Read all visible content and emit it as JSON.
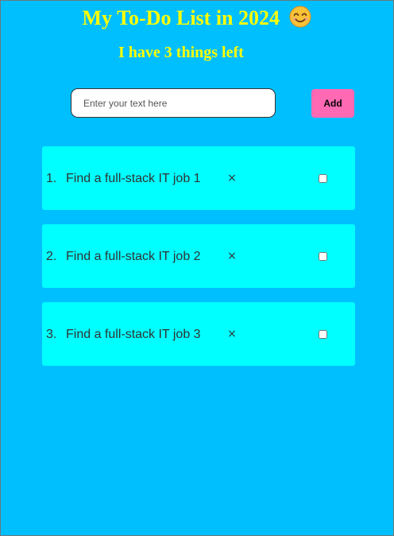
{
  "header": {
    "title": "My To-Do List in 2024",
    "subtitle": "I have 3 things left"
  },
  "form": {
    "input_placeholder": "Enter your text here",
    "input_value": "",
    "add_label": "Add"
  },
  "todos": [
    {
      "number": "1.",
      "text": "Find a full-stack IT job 1",
      "delete_label": "×",
      "done": false
    },
    {
      "number": "2.",
      "text": "Find a full-stack IT job 2",
      "delete_label": "×",
      "done": false
    },
    {
      "number": "3.",
      "text": "Find a full-stack IT job 3",
      "delete_label": "×",
      "done": false
    }
  ],
  "colors": {
    "background": "#00bfff",
    "title": "#ffff00",
    "item_background": "#00ffff",
    "add_button": "#ff69b4"
  },
  "icons": {
    "title_emoji": "smiling-face-icon",
    "delete": "close-icon"
  }
}
